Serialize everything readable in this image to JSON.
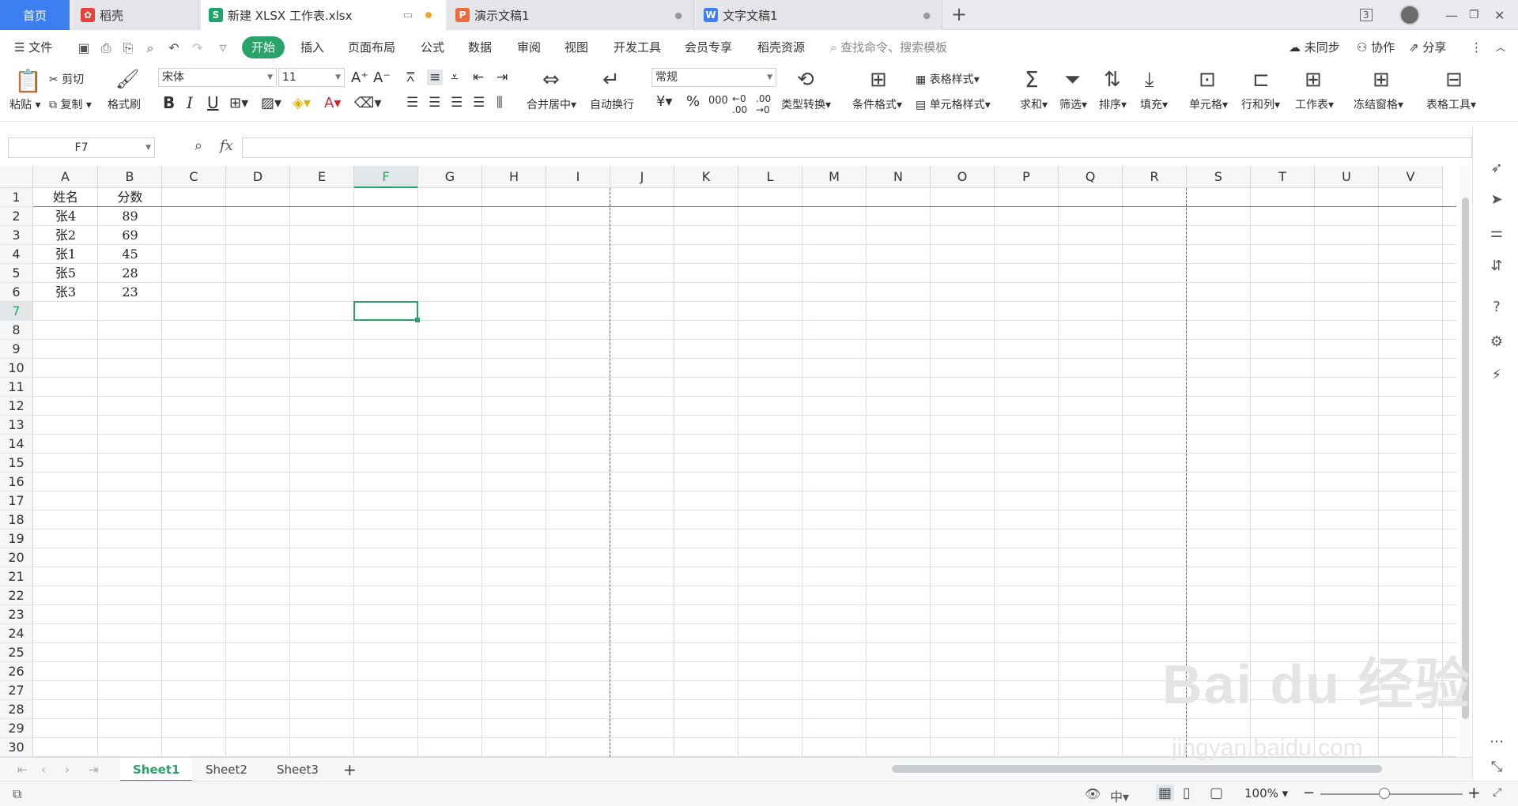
{
  "tabs": {
    "home": "首页",
    "daoke": "稻壳",
    "xlsx": "新建 XLSX 工作表.xlsx",
    "ppt": "演示文稿1",
    "doc": "文字文稿1",
    "badge": "3"
  },
  "menu": {
    "file": "文件",
    "items": [
      "开始",
      "插入",
      "页面布局",
      "公式",
      "数据",
      "审阅",
      "视图",
      "开发工具",
      "会员专享",
      "稻壳资源"
    ],
    "search_placeholder": "查找命令、搜索模板",
    "unsynced": "未同步",
    "collab": "协作",
    "share": "分享"
  },
  "ribbon": {
    "paste": "粘贴",
    "cut": "剪切",
    "copy": "复制",
    "format_painter": "格式刷",
    "font": "宋体",
    "font_size": "11",
    "merge_center": "合并居中",
    "wrap": "自动换行",
    "number_format": "常规",
    "type_convert": "类型转换",
    "cond_format": "条件格式",
    "table_style": "表格样式",
    "cell_style": "单元格样式",
    "sum": "求和",
    "filter": "筛选",
    "sort": "排序",
    "fill": "填充",
    "cell": "单元格",
    "row_col": "行和列",
    "worksheet": "工作表",
    "freeze": "冻结窗格",
    "table_tools": "表格工具",
    "bold": "B",
    "italic": "I",
    "underline": "U",
    "currency": "¥",
    "percent": "%",
    "thousands": "000"
  },
  "formula": {
    "cell_ref": "F7",
    "fx": "fx",
    "content": ""
  },
  "sheet": {
    "columns": [
      "A",
      "B",
      "C",
      "D",
      "E",
      "F",
      "G",
      "H",
      "I",
      "J",
      "K",
      "L",
      "M",
      "N",
      "O",
      "P",
      "Q",
      "R",
      "S",
      "T",
      "U",
      "V"
    ],
    "rows": [
      "1",
      "2",
      "3",
      "4",
      "5",
      "6",
      "7",
      "8",
      "9",
      "10",
      "11",
      "12",
      "13",
      "14",
      "15",
      "16",
      "17",
      "18",
      "19",
      "20",
      "21",
      "22",
      "23",
      "24",
      "25",
      "26",
      "27",
      "28",
      "29",
      "30"
    ],
    "selected_col": "F",
    "selected_row": "7",
    "cells": [
      [
        "姓名",
        "分数"
      ],
      [
        "张4",
        "89"
      ],
      [
        "张2",
        "69"
      ],
      [
        "张1",
        "45"
      ],
      [
        "张5",
        "28"
      ],
      [
        "张3",
        "23"
      ]
    ]
  },
  "sheet_tabs": [
    "Sheet1",
    "Sheet2",
    "Sheet3"
  ],
  "status": {
    "zoom": "100%"
  },
  "watermark": {
    "line1": "Bai du 经验",
    "line2": "jingyan.baidu.com"
  }
}
